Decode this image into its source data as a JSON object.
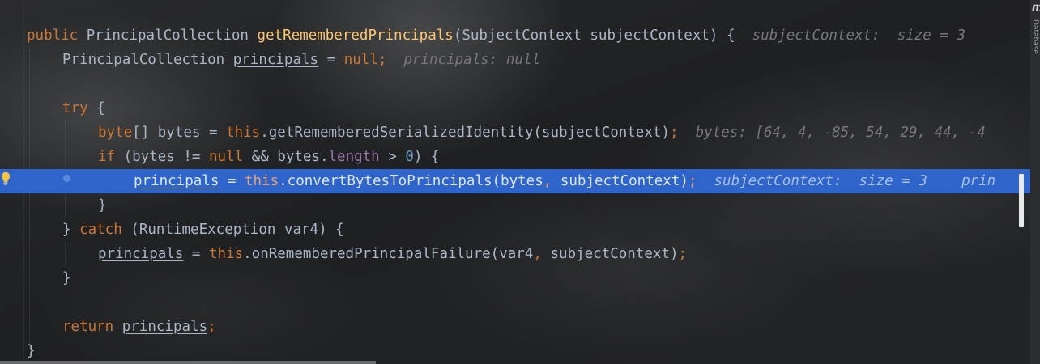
{
  "lines": [
    {
      "id": "method-signature",
      "code": {
        "t1": "public",
        "t2": " PrincipalCollection ",
        "t3": "getRememberedPrincipals",
        "t4": "(SubjectContext subjectContext) {  "
      },
      "hint": "subjectContext:  size = 3"
    },
    {
      "id": "principals-declaration",
      "code": {
        "t1": "PrincipalCollection ",
        "t2": "principals",
        "t3": " = ",
        "t4": "null;"
      },
      "hint": "principals: null"
    },
    {
      "id": "try-line",
      "code": {
        "t1": "try",
        "t2": " {"
      }
    },
    {
      "id": "bytes-declaration",
      "code": {
        "t1": "byte",
        "t2": "[] bytes = ",
        "t3": "this",
        "t4": ".getRememberedSerializedIdentity(subjectContext)",
        "t5": ";"
      },
      "hint": "bytes: [64, 4, -85, 54, 29, 44, -4"
    },
    {
      "id": "if-line",
      "code": {
        "t1": "if",
        "t2": " (bytes != ",
        "t3": "null",
        "t4": " && bytes.",
        "t5": "length",
        "t6": " > ",
        "t7": "0",
        "t8": ") {"
      }
    },
    {
      "id": "current-execution-line",
      "code": {
        "t1": "principals",
        "t2": " = ",
        "t3": "this",
        "t4": ".convertBytesToPrincipals(bytes",
        "t5": ",",
        "t6": " subjectContext)",
        "t7": ";"
      },
      "hint": "subjectContext:  size = 3",
      "hint2": "prin"
    },
    {
      "id": "if-close",
      "code": {
        "t1": "}"
      }
    },
    {
      "id": "catch-line",
      "code": {
        "t1": "} ",
        "t2": "catch",
        "t3": " (RuntimeException var4) {"
      }
    },
    {
      "id": "failure-line",
      "code": {
        "t1": "principals",
        "t2": " = ",
        "t3": "this",
        "t4": ".onRememberedPrincipalFailure(var4",
        "t5": ",",
        "t6": " subjectContext)",
        "t7": ";"
      }
    },
    {
      "id": "try-close",
      "code": {
        "t1": "}"
      }
    },
    {
      "id": "return-line",
      "code": {
        "t1": "return",
        "t2": " ",
        "t3": "principals",
        "t4": ";"
      }
    },
    {
      "id": "method-close",
      "code": {
        "t1": "}"
      }
    }
  ],
  "right_strip": {
    "letter": "m",
    "label": "Database"
  },
  "colors": {
    "keyword": "#cc7832",
    "method_decl": "#ffc66d",
    "number": "#6897bb",
    "field": "#9876aa",
    "text": "#a9b7c6",
    "hint": "#787878",
    "execution_line": "#2f65ca"
  },
  "icons": {
    "gutter": "lightbulb-icon"
  }
}
